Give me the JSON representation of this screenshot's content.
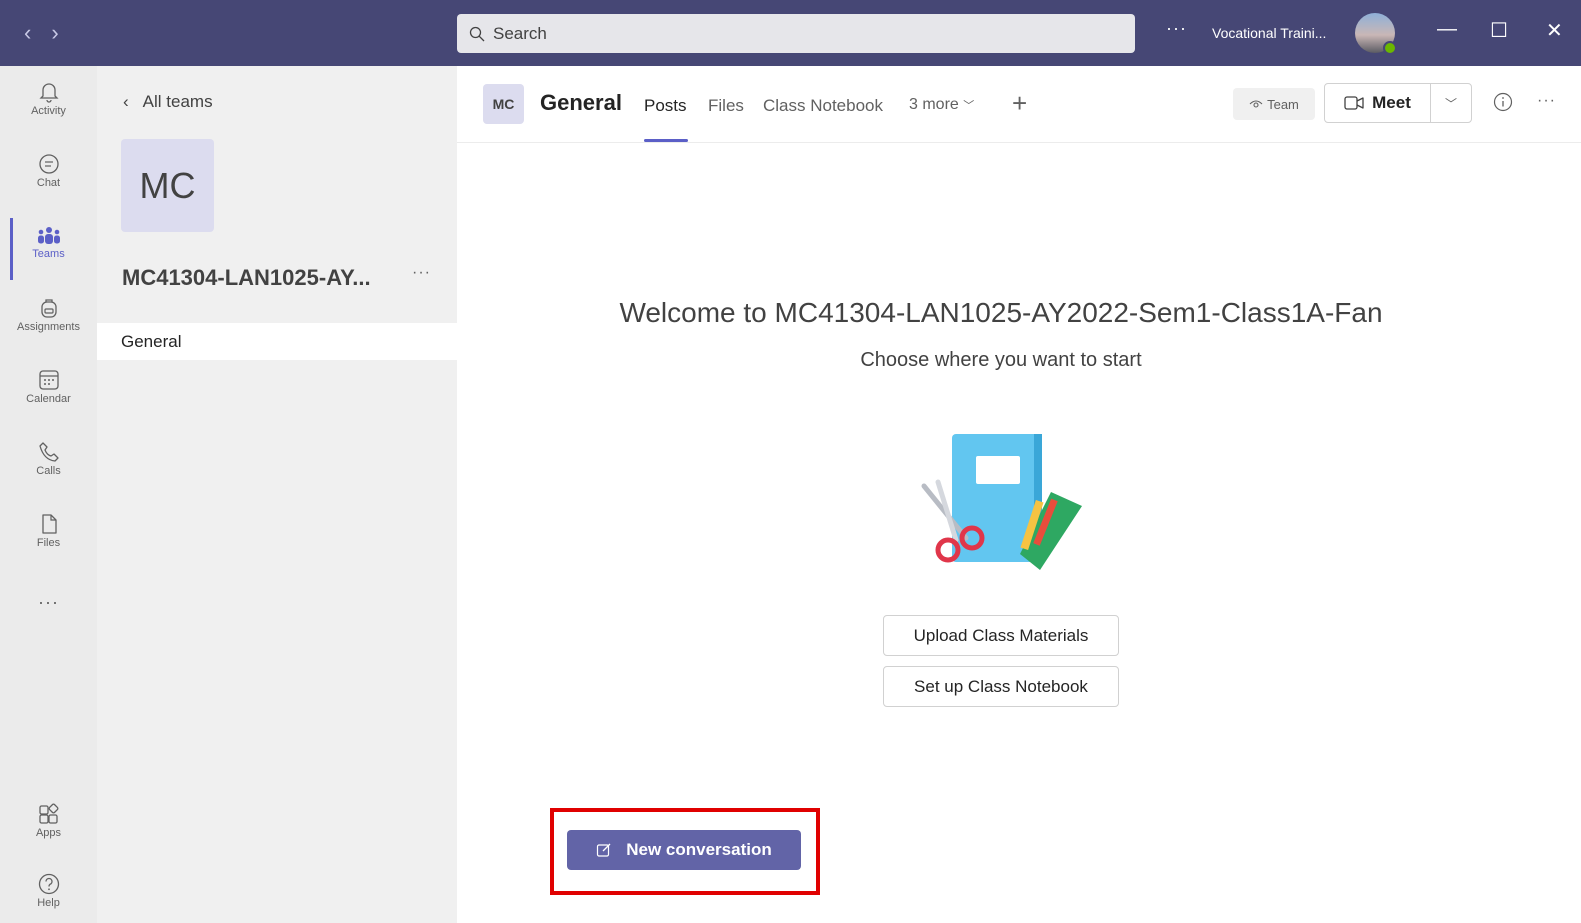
{
  "titlebar": {
    "back_arrow": "‹",
    "forward_arrow": "›",
    "search_placeholder": "Search",
    "more": "···",
    "tenant": "Vocational Traini...",
    "minimize": "—",
    "maximize": "☐",
    "close": "✕"
  },
  "rail": {
    "items": [
      {
        "label": "Activity",
        "icon": "bell-icon"
      },
      {
        "label": "Chat",
        "icon": "chat-icon"
      },
      {
        "label": "Teams",
        "icon": "teams-icon"
      },
      {
        "label": "Assignments",
        "icon": "backpack-icon"
      },
      {
        "label": "Calendar",
        "icon": "calendar-icon"
      },
      {
        "label": "Calls",
        "icon": "phone-icon"
      },
      {
        "label": "Files",
        "icon": "file-icon"
      },
      {
        "label": "Apps",
        "icon": "apps-icon"
      },
      {
        "label": "Help",
        "icon": "help-icon"
      }
    ],
    "active": "Teams",
    "more": "···"
  },
  "teampane": {
    "back_label": "All teams",
    "team_initials": "MC",
    "team_name": "MC41304-LAN1025-AY...",
    "team_more": "···",
    "channels": [
      "General"
    ]
  },
  "header": {
    "badge": "MC",
    "channel_title": "General",
    "tabs": [
      "Posts",
      "Files",
      "Class Notebook",
      "3 more"
    ],
    "active_tab": "Posts",
    "add": "+",
    "team_pill": "Team",
    "meet_label": "Meet",
    "more": "···"
  },
  "main": {
    "welcome": "Welcome to MC41304-LAN1025-AY2022-Sem1-Class1A-Fan",
    "subtitle": "Choose where you want to start",
    "upload_button": "Upload Class Materials",
    "notebook_button": "Set up Class Notebook",
    "new_conversation": "New conversation"
  },
  "colors": {
    "titlebar": "#464775",
    "accent": "#5b5fc7",
    "primary_button": "#6264a7",
    "highlight": "#e00000"
  }
}
